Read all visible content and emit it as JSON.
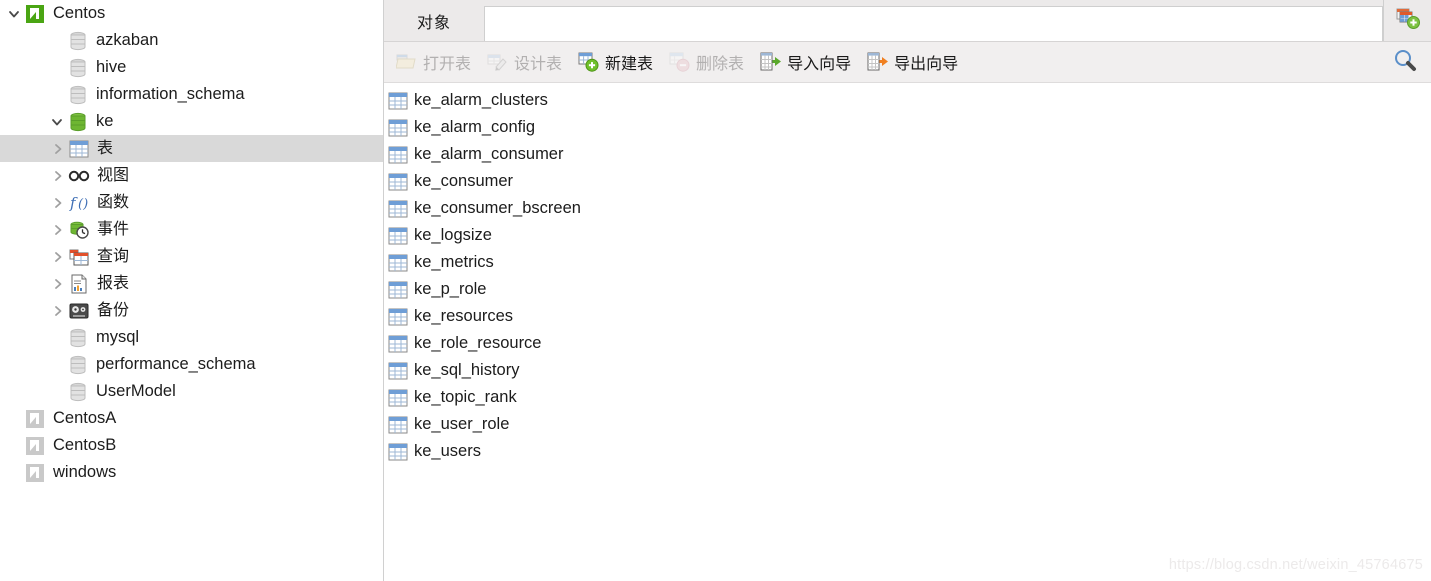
{
  "sidebar": {
    "tree": [
      {
        "label": "Centos",
        "indent": 0,
        "icon": "connection-green-icon",
        "twisty": "down",
        "selected": false,
        "cjk": false
      },
      {
        "label": "azkaban",
        "indent": 1,
        "icon": "database-grey-icon",
        "twisty": "none",
        "selected": false,
        "cjk": false
      },
      {
        "label": "hive",
        "indent": 1,
        "icon": "database-grey-icon",
        "twisty": "none",
        "selected": false,
        "cjk": false
      },
      {
        "label": "information_schema",
        "indent": 1,
        "icon": "database-grey-icon",
        "twisty": "none",
        "selected": false,
        "cjk": false
      },
      {
        "label": "ke",
        "indent": 1,
        "icon": "database-green-icon",
        "twisty": "down",
        "selected": false,
        "cjk": false
      },
      {
        "label": "表",
        "indent": 2,
        "icon": "table-icon",
        "twisty": "right",
        "selected": true,
        "cjk": true
      },
      {
        "label": "视图",
        "indent": 2,
        "icon": "view-glasses-icon",
        "twisty": "right",
        "selected": false,
        "cjk": true
      },
      {
        "label": "函数",
        "indent": 2,
        "icon": "function-icon",
        "twisty": "right",
        "selected": false,
        "cjk": true
      },
      {
        "label": "事件",
        "indent": 2,
        "icon": "event-clock-icon",
        "twisty": "right",
        "selected": false,
        "cjk": true
      },
      {
        "label": "查询",
        "indent": 2,
        "icon": "query-icon",
        "twisty": "right",
        "selected": false,
        "cjk": true
      },
      {
        "label": "报表",
        "indent": 2,
        "icon": "report-icon",
        "twisty": "right",
        "selected": false,
        "cjk": true
      },
      {
        "label": "备份",
        "indent": 2,
        "icon": "backup-icon",
        "twisty": "right",
        "selected": false,
        "cjk": true
      },
      {
        "label": "mysql",
        "indent": 1,
        "icon": "database-grey-icon",
        "twisty": "none",
        "selected": false,
        "cjk": false
      },
      {
        "label": "performance_schema",
        "indent": 1,
        "icon": "database-grey-icon",
        "twisty": "none",
        "selected": false,
        "cjk": false
      },
      {
        "label": "UserModel",
        "indent": 1,
        "icon": "database-grey-icon",
        "twisty": "none",
        "selected": false,
        "cjk": false
      },
      {
        "label": "CentosA",
        "indent": 0,
        "icon": "connection-grey-icon",
        "twisty": "none",
        "selected": false,
        "cjk": false
      },
      {
        "label": "CentosB",
        "indent": 0,
        "icon": "connection-grey-icon",
        "twisty": "none",
        "selected": false,
        "cjk": false
      },
      {
        "label": "windows",
        "indent": 0,
        "icon": "connection-grey-icon",
        "twisty": "none",
        "selected": false,
        "cjk": false
      }
    ]
  },
  "tabs": {
    "object_tab_label": "对象",
    "new_object_icon": "new-object-plus-icon"
  },
  "toolbar": {
    "items": [
      {
        "label": "打开表",
        "icon": "open-table-icon",
        "disabled": true
      },
      {
        "label": "设计表",
        "icon": "design-table-icon",
        "disabled": true
      },
      {
        "label": "新建表",
        "icon": "new-table-icon",
        "disabled": false
      },
      {
        "label": "删除表",
        "icon": "delete-table-icon",
        "disabled": true
      },
      {
        "label": "导入向导",
        "icon": "import-wizard-icon",
        "disabled": false
      },
      {
        "label": "导出向导",
        "icon": "export-wizard-icon",
        "disabled": false
      }
    ],
    "search_icon": "search-icon"
  },
  "object_list": {
    "items": [
      "ke_alarm_clusters",
      "ke_alarm_config",
      "ke_alarm_consumer",
      "ke_consumer",
      "ke_consumer_bscreen",
      "ke_logsize",
      "ke_metrics",
      "ke_p_role",
      "ke_resources",
      "ke_role_resource",
      "ke_sql_history",
      "ke_topic_rank",
      "ke_user_role",
      "ke_users"
    ]
  },
  "watermark": {
    "text": "https://blog.csdn.net/weixin_45764675"
  },
  "colors": {
    "selection": "#d9d9d9",
    "toolbar_bg": "#f1efef",
    "tab_bg": "#eceaea",
    "accent_green": "#5aa82b",
    "accent_orange": "#f07f20",
    "accent_blue": "#4a7ebb",
    "disabled_text": "#b2b0b0"
  }
}
